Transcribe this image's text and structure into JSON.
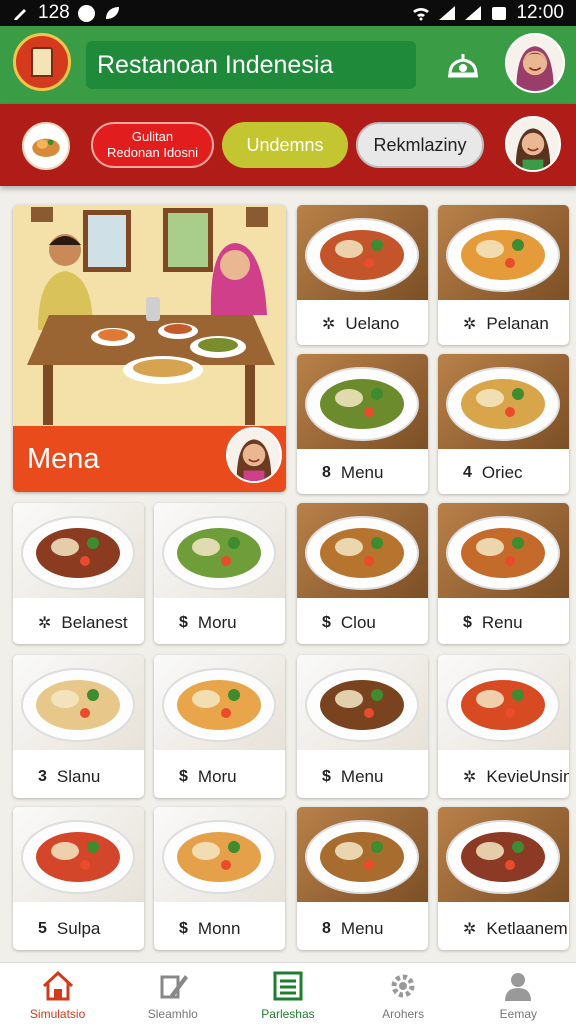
{
  "status_bar": {
    "notification_count": "128",
    "time": "12:00"
  },
  "header": {
    "title": "Restanoan Indenesia",
    "settings_icon": "settings-icon",
    "logo_icon": "tower-logo-icon"
  },
  "category_bar": {
    "pill_red_line1": "Gulitan",
    "pill_red_line2": "Redonan Idosni",
    "pill_lime": "Undemns",
    "pill_gray": "Rekmlaziny"
  },
  "hero": {
    "label": "Mena"
  },
  "menu_cards": [
    {
      "prefix": "✲",
      "label": "Uelano"
    },
    {
      "prefix": "✲",
      "label": "Pelanan"
    },
    {
      "prefix": "8",
      "label": "Menu"
    },
    {
      "prefix": "4",
      "label": "Oriec"
    },
    {
      "prefix": "✲",
      "label": "Belanest"
    },
    {
      "prefix": "$",
      "label": "Moru"
    },
    {
      "prefix": "$",
      "label": "Clou"
    },
    {
      "prefix": "$",
      "label": "Renu"
    },
    {
      "prefix": "3",
      "label": "Slanu"
    },
    {
      "prefix": "$",
      "label": "Moru"
    },
    {
      "prefix": "$",
      "label": "Menu"
    },
    {
      "prefix": "✲",
      "label": "KevieUnsin"
    },
    {
      "prefix": "5",
      "label": "Sulpa"
    },
    {
      "prefix": "$",
      "label": "Monn"
    },
    {
      "prefix": "8",
      "label": "Menu"
    },
    {
      "prefix": "✲",
      "label": "Ketlaanem"
    }
  ],
  "bottom_nav": [
    {
      "label": "Simulatsio",
      "icon": "home-icon"
    },
    {
      "label": "Sleamhlo",
      "icon": "edit-tools-icon"
    },
    {
      "label": "Parleshas",
      "icon": "list-icon"
    },
    {
      "label": "Arohers",
      "icon": "gear-icon"
    },
    {
      "label": "Eemay",
      "icon": "user-icon"
    }
  ],
  "colors": {
    "header_green": "#3a9c45",
    "category_red": "#b01d18",
    "accent_orange": "#ea4b1d"
  }
}
